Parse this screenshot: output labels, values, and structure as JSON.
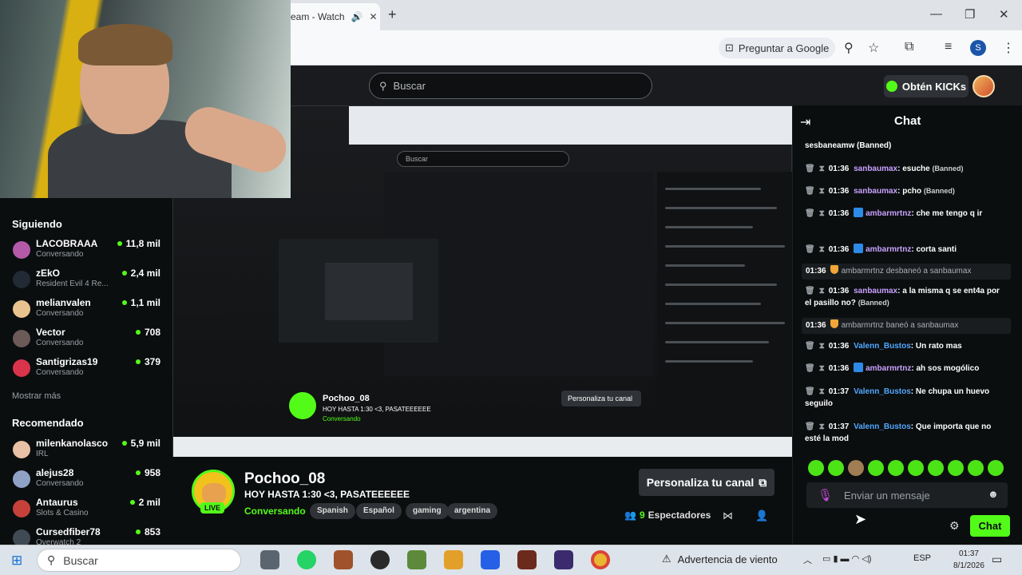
{
  "browser": {
    "tab_title": "eam - Watch",
    "new_tab": "+",
    "google_pill": "Preguntar a Google",
    "profile_initial": "S",
    "window_buttons": [
      "—",
      "❐",
      "✕"
    ]
  },
  "header": {
    "search_placeholder": "Buscar",
    "kicks_label": "Obtén KICKs"
  },
  "sidebar": {
    "following_title": "Siguiendo",
    "following": [
      {
        "name": "LACOBRAAA",
        "sub": "Conversando",
        "count": "11,8 mil",
        "color": "#b45aa8"
      },
      {
        "name": "zEkO",
        "sub": "Resident Evil 4 Re...",
        "count": "2,4 mil",
        "color": "#222a35"
      },
      {
        "name": "melianvalen",
        "sub": "Conversando",
        "count": "1,1 mil",
        "color": "#e9c38f"
      },
      {
        "name": "Vector",
        "sub": "Conversando",
        "count": "708",
        "color": "#6b5a58"
      },
      {
        "name": "Santigrizas19",
        "sub": "Conversando",
        "count": "379",
        "color": "#d9344b"
      }
    ],
    "show_more": "Mostrar más",
    "recommended_title": "Recomendado",
    "recommended": [
      {
        "name": "milenkanolasco",
        "sub": "IRL",
        "count": "5,9 mil",
        "color": "#e8c0a5"
      },
      {
        "name": "alejus28",
        "sub": "Conversando",
        "count": "958",
        "color": "#8fa2c6"
      },
      {
        "name": "Antaurus",
        "sub": "Slots & Casino",
        "count": "2 mil",
        "color": "#c7413b"
      },
      {
        "name": "Cursedfiber78",
        "sub": "Overwatch 2",
        "count": "853",
        "color": "#3f4a55"
      }
    ]
  },
  "stream": {
    "streamer": "Pochoo_08",
    "title": "HOY HASTA 1:30 <3, PASATEEEEEE",
    "category": "Conversando",
    "tags": [
      "Spanish",
      "Español",
      "gaming",
      "argentina"
    ],
    "live": "LIVE",
    "customize": "Personaliza tu canal",
    "viewers_count": "9",
    "viewers_label": "Espectadores"
  },
  "nested": {
    "search": "Buscar",
    "streamer": "Pochoo_08",
    "title": "HOY HASTA 1:30 <3, PASATEEEEEE",
    "category": "Conversando",
    "customize": "Personaliza tu canal"
  },
  "chat": {
    "title": "Chat",
    "messages": [
      {
        "kind": "cut",
        "text": "sesbaneamw (Banned)"
      },
      {
        "kind": "msg",
        "ts": "01:36",
        "user": "sanbaumax",
        "ucolor": "u1",
        "badge": false,
        "text": "esuche",
        "banned": "(Banned)"
      },
      {
        "kind": "msg",
        "ts": "01:36",
        "user": "sanbaumax",
        "ucolor": "u1",
        "badge": false,
        "text": "pcho",
        "banned": "(Banned)"
      },
      {
        "kind": "msg",
        "ts": "01:36",
        "user": "ambarmrtnz",
        "ucolor": "u1",
        "badge": true,
        "text": "che me tengo q ir",
        "banned": ""
      },
      {
        "kind": "msg",
        "ts": "01:36",
        "user": "ambarmrtnz",
        "ucolor": "u1",
        "badge": true,
        "text": "corta santi",
        "banned": ""
      },
      {
        "kind": "sys",
        "ts": "01:36",
        "text": "ambarmrtnz desbaneó a sanbaumax"
      },
      {
        "kind": "msg",
        "ts": "01:36",
        "user": "sanbaumax",
        "ucolor": "u1",
        "badge": false,
        "text": "a la misma q se ent4a por el pasillo no?",
        "banned": "(Banned)"
      },
      {
        "kind": "sys",
        "ts": "01:36",
        "text": "ambarmrtnz baneó a sanbaumax"
      },
      {
        "kind": "msg",
        "ts": "01:36",
        "user": "Valenn_Bustos",
        "ucolor": "u2",
        "badge": false,
        "text": "Un rato mas",
        "banned": ""
      },
      {
        "kind": "msg",
        "ts": "01:36",
        "user": "ambarmrtnz",
        "ucolor": "u1",
        "badge": true,
        "text": "ah sos mogólico",
        "banned": ""
      },
      {
        "kind": "msg",
        "ts": "01:37",
        "user": "Valenn_Bustos",
        "ucolor": "u2",
        "badge": false,
        "text": "Ne chupa un huevo seguilo",
        "banned": ""
      },
      {
        "kind": "msg",
        "ts": "01:37",
        "user": "Valenn_Bustos",
        "ucolor": "u2",
        "badge": false,
        "text": "Que importa que no esté la mod",
        "banned": ""
      }
    ],
    "input_placeholder": "Enviar un mensaje",
    "send": "Chat"
  },
  "taskbar": {
    "search": "Buscar",
    "weather": "Advertencia de viento",
    "lang": "ESP",
    "time": "01:37",
    "date": "8/1/2026"
  },
  "icons": {
    "search": "search-icon",
    "mic": "mic-icon",
    "gear": "gear-icon",
    "share": "share-icon",
    "viewers": "users-icon"
  },
  "colors": {
    "kick_green": "#53fc18",
    "background": "#0b0e0f",
    "panel": "#2f3337"
  }
}
